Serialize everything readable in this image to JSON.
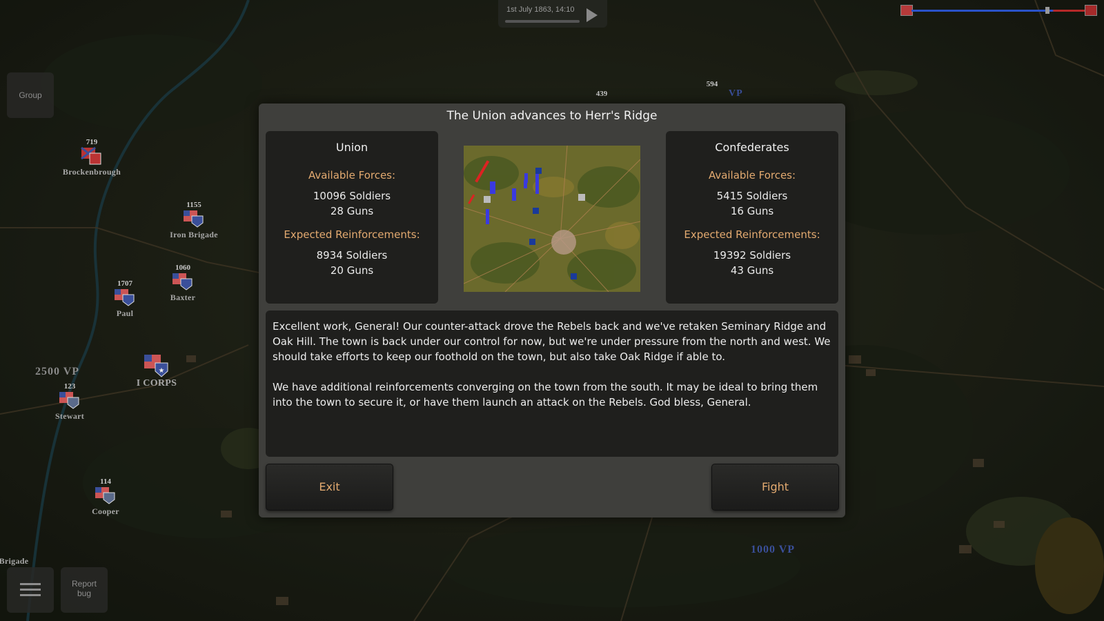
{
  "top_bar": {
    "date_time": "1st July 1863, 14:10"
  },
  "side_buttons": {
    "group": "Group",
    "report_bug_line1": "Report",
    "report_bug_line2": "bug"
  },
  "map": {
    "units": [
      {
        "id": "brockenbrough",
        "strength": "719",
        "name": "Brockenbrough"
      },
      {
        "id": "iron-brigade",
        "strength": "1155",
        "name": "Iron Brigade"
      },
      {
        "id": "baxter",
        "strength": "1060",
        "name": "Baxter"
      },
      {
        "id": "paul",
        "strength": "1707",
        "name": "Paul"
      },
      {
        "id": "stewart",
        "strength": "123",
        "name": "Stewart"
      },
      {
        "id": "cooper",
        "strength": "114",
        "name": "Cooper"
      },
      {
        "id": "corps",
        "strength": "",
        "name": "I CORPS"
      },
      {
        "id": "brigade-edge",
        "strength": "",
        "name": "Brigade"
      },
      {
        "id": "unit-439",
        "strength": "439",
        "name": ""
      },
      {
        "id": "unit-594",
        "strength": "594",
        "name": ""
      }
    ],
    "vp_labels": [
      "2500 VP",
      "1000 VP",
      "VP"
    ]
  },
  "dialog": {
    "title": "The Union advances to Herr's Ridge",
    "union": {
      "name": "Union",
      "available_label": "Available Forces:",
      "available_soldiers": "10096 Soldiers",
      "available_guns": "28 Guns",
      "reinforcements_label": "Expected Reinforcements:",
      "reinforcement_soldiers": "8934 Soldiers",
      "reinforcement_guns": "20 Guns"
    },
    "confederates": {
      "name": "Confederates",
      "available_label": "Available Forces:",
      "available_soldiers": "5415 Soldiers",
      "available_guns": "16 Guns",
      "reinforcements_label": "Expected Reinforcements:",
      "reinforcement_soldiers": "19392 Soldiers",
      "reinforcement_guns": "43 Guns"
    },
    "message_p1": "Excellent work, General! Our counter-attack drove the Rebels back and we've retaken Seminary Ridge and Oak Hill. The  town is back under our control for now, but we're under pressure from the north and west. We should take efforts to keep our foothold on the town, but also take Oak Ridge if able to.",
    "message_p2": "We have additional reinforcements converging on the town from the south. It may be ideal to bring them into the town to secure it, or have them launch an attack on the Rebels. God bless, General.",
    "exit_label": "Exit",
    "fight_label": "Fight"
  },
  "colors": {
    "accent_orange": "#e3aa70",
    "union_blue": "#2a52c8",
    "confederate_red": "#b52828"
  }
}
